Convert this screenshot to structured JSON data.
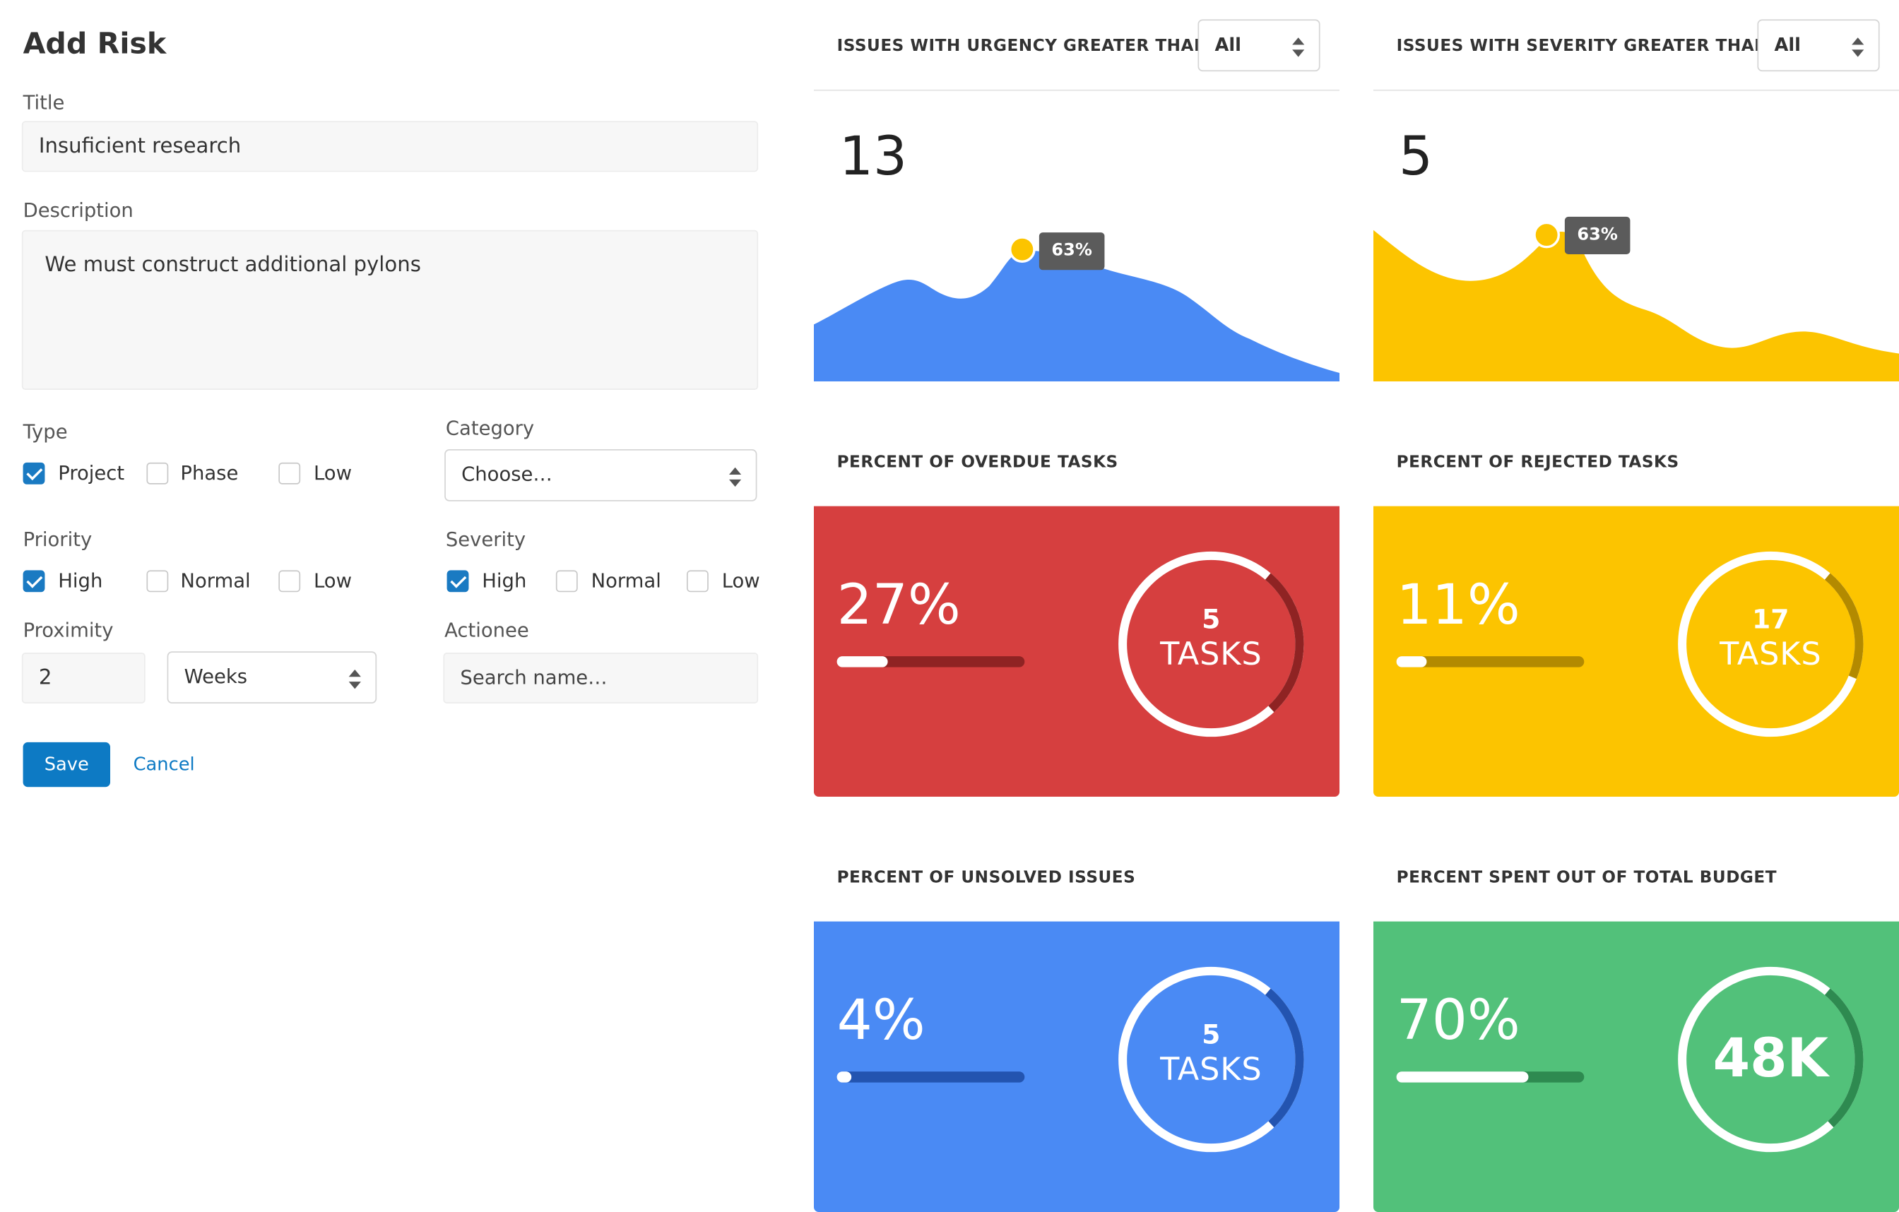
{
  "form": {
    "title": "Add Risk",
    "title_label": "Title",
    "title_value": "Insuficient research",
    "description_label": "Description",
    "description_value": "We must construct additional pylons",
    "type": {
      "label": "Type",
      "options": [
        {
          "label": "Project",
          "checked": true
        },
        {
          "label": "Phase",
          "checked": false
        },
        {
          "label": "Low",
          "checked": false
        }
      ]
    },
    "category": {
      "label": "Category",
      "value": "Choose…"
    },
    "priority": {
      "label": "Priority",
      "options": [
        {
          "label": "High",
          "checked": true
        },
        {
          "label": "Normal",
          "checked": false
        },
        {
          "label": "Low",
          "checked": false
        }
      ]
    },
    "severity": {
      "label": "Severity",
      "options": [
        {
          "label": "High",
          "checked": true
        },
        {
          "label": "Normal",
          "checked": false
        },
        {
          "label": "Low",
          "checked": false
        }
      ]
    },
    "proximity": {
      "label": "Proximity",
      "value": "2",
      "unit": "Weeks"
    },
    "actionee": {
      "label": "Actionee",
      "placeholder": "Search name…"
    },
    "save_label": "Save",
    "cancel_label": "Cancel"
  },
  "urgency_card": {
    "title": "ISSUES WITH URGENCY GREATER THAN",
    "filter": "All",
    "value": "13",
    "tooltip": "63%",
    "color": "#4a8af4"
  },
  "severity_card": {
    "title": "ISSUES WITH SEVERITY GREATER THAN",
    "filter": "All",
    "value": "5",
    "tooltip": "63%",
    "color": "#fcc400"
  },
  "stat_cards": [
    {
      "title": "PERCENT OF OVERDUE TASKS",
      "percent": "27%",
      "progress": 0.27,
      "circle_num": "5",
      "circle_label": "TASKS",
      "circle_progress": 0.27,
      "color": "#d63f3f",
      "dark": "#8f2323"
    },
    {
      "title": "PERCENT OF REJECTED TASKS",
      "percent": "11%",
      "progress": 0.16,
      "circle_num": "17",
      "circle_label": "TASKS",
      "circle_progress": 0.2,
      "color": "#fcc400",
      "dark": "#b38a00"
    },
    {
      "title": "PERCENT OF UNSOLVED ISSUES",
      "percent": "4%",
      "progress": 0.08,
      "circle_num": "5",
      "circle_label": "TASKS",
      "circle_progress": 0.27,
      "color": "#4a8af4",
      "dark": "#2354b0"
    },
    {
      "title": "PERCENT SPENT OUT OF TOTAL BUDGET",
      "percent": "70%",
      "progress": 0.7,
      "circle_big": "48K",
      "circle_progress": 0.27,
      "color": "#52c17a",
      "dark": "#2e8a50"
    }
  ]
}
